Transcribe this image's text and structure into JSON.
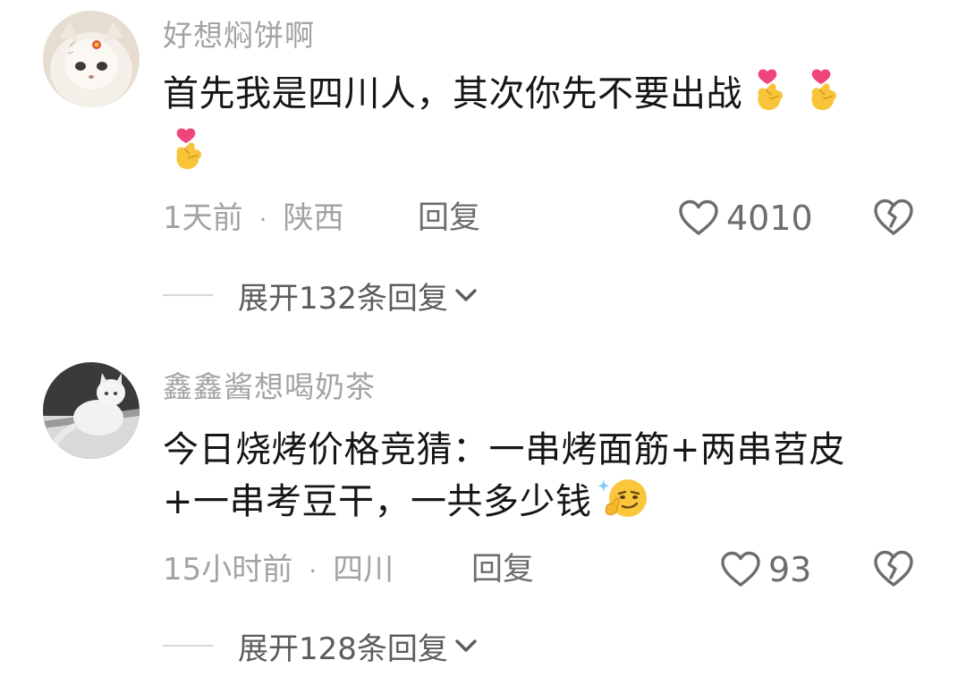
{
  "comments": [
    {
      "username": "好想焖饼啊",
      "text": "首先我是四川人，其次你先不要出战",
      "emojis": [
        "finger-heart-emoji",
        "finger-heart-emoji",
        "finger-heart-emoji"
      ],
      "time": "1天前",
      "location": "陕西",
      "separator": "·",
      "reply_label": "回复",
      "likes": "4010",
      "expand_label": "展开132条回复"
    },
    {
      "username": "鑫鑫酱想喝奶茶",
      "text_line1": "今日烧烤价格竞猜：一串烤面筋+两串苕皮",
      "text_line2": "+一串考豆干，一共多少钱",
      "emojis": [
        "smirk-thinking-emoji"
      ],
      "time": "15小时前",
      "location": "四川",
      "separator": "·",
      "reply_label": "回复",
      "likes": "93",
      "expand_label": "展开128条回复"
    }
  ],
  "icons": {
    "like": "heart-outline-icon",
    "dislike": "broken-heart-icon",
    "expand": "chevron-down-icon"
  },
  "colors": {
    "username": "#a3a3a3",
    "content": "#161616",
    "meta": "#a3a3a3",
    "action": "#6d6d6d"
  }
}
